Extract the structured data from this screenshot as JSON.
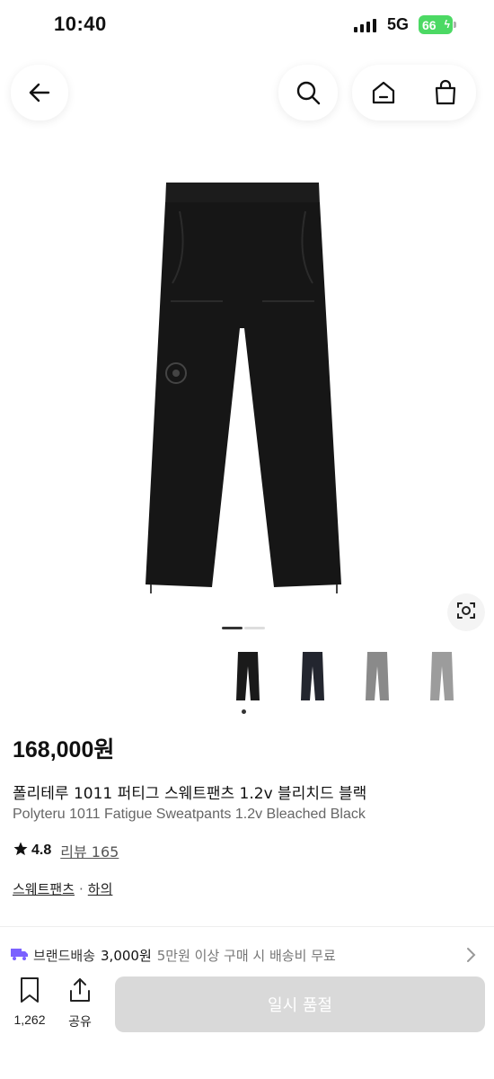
{
  "status_bar": {
    "time": "10:40",
    "network": "5G",
    "battery": "66"
  },
  "nav": {
    "back_icon": "arrow-left-icon",
    "search_icon": "search-icon",
    "home_icon": "home-icon",
    "cart_icon": "shopping-bag-icon"
  },
  "gallery": {
    "current_index": 1,
    "total": 2,
    "thumbnails": [
      {
        "color_name": "black",
        "color": "#1a1a1a"
      },
      {
        "color_name": "navy",
        "color": "#23262f"
      },
      {
        "color_name": "gray",
        "color": "#8a8a8a"
      },
      {
        "color_name": "light-gray",
        "color": "#9c9c9c"
      }
    ]
  },
  "product": {
    "price": "168,000원",
    "name_ko": "폴리테루 1011 퍼티그 스웨트팬츠 1.2v 블리치드 블랙",
    "name_en": "Polyteru 1011 Fatigue Sweatpants 1.2v Bleached Black",
    "rating": "4.8",
    "review_label": "리뷰 165",
    "category": "스웨트팬츠",
    "category_sep": "·",
    "parent_category": "하의"
  },
  "shipping": {
    "brand_label": "브랜드배송",
    "fee": "3,000원",
    "note": "5만원 이상 구매 시 배송비 무료"
  },
  "bottom_bar": {
    "wish_count": "1,262",
    "share_label": "공유",
    "sold_out_label": "일시 품절"
  },
  "colors": {
    "accent_truck": "#7b61ff",
    "disabled_button": "#d9d9d9",
    "battery_green": "#4cd964"
  }
}
